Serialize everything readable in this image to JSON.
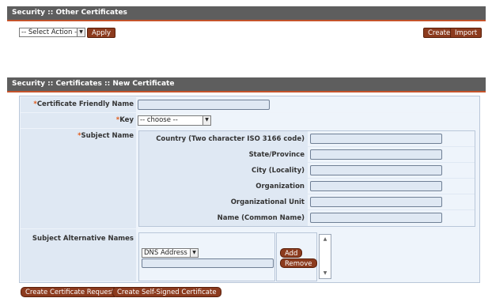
{
  "other_certs": {
    "title": "Security :: Other Certificates",
    "select_action": "-- Select Action --",
    "apply": "Apply",
    "create": "Create",
    "import": "Import"
  },
  "new_cert": {
    "title": "Security :: Certificates :: New Certificate",
    "friendly_name_label": "Certificate Friendly Name",
    "key_label": "Key",
    "key_value": "-- choose --",
    "subject_name_label": "Subject Name",
    "subject_fields": [
      "Country (Two character ISO 3166 code)",
      "State/Province",
      "City (Locality)",
      "Organization",
      "Organizational Unit",
      "Name (Common Name)"
    ],
    "san_label": "Subject Alternative Names",
    "san_type": "DNS Address",
    "add": "Add",
    "remove": "Remove",
    "create_request": "Create Certificate Request",
    "create_self_signed": "Create Self-Signed Certificate"
  },
  "colors": {
    "header_bg": "#5e5e5e",
    "accent": "#c4532b",
    "button": "#8c3b1e",
    "required": "#e05a1a"
  }
}
